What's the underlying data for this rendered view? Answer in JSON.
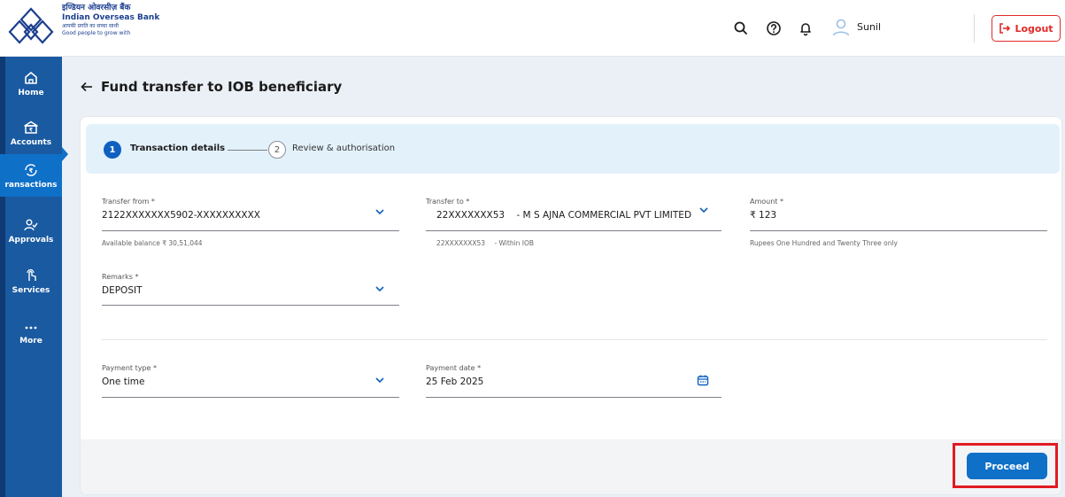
{
  "header": {
    "brand_hindi": "इण्डियन ओवरसीज़ बैंक",
    "brand_name": "Indian Overseas Bank",
    "tagline_hindi": "आपकी प्रगति का सच्चा साथी",
    "tagline": "Good people to grow with",
    "user_name": "Sunil",
    "logout_label": "Logout",
    "icons": [
      "search-icon",
      "help-icon",
      "bell-icon",
      "user-icon"
    ]
  },
  "sidebar": {
    "items": [
      {
        "label": "Home",
        "icon": "home-icon"
      },
      {
        "label": "Accounts",
        "icon": "bank-icon"
      },
      {
        "label": "ransactions",
        "icon": "rupee-exchange-icon",
        "active": true
      },
      {
        "label": "Approvals",
        "icon": "approvals-icon"
      },
      {
        "label": "Services",
        "icon": "hand-tap-icon"
      },
      {
        "label": "More",
        "icon": "more-dots-icon"
      }
    ]
  },
  "page": {
    "title": "Fund transfer to IOB beneficiary"
  },
  "stepper": {
    "steps": [
      {
        "number": "1",
        "label": "Transaction details",
        "active": true
      },
      {
        "number": "2",
        "label": "Review & authorisation",
        "active": false
      }
    ]
  },
  "form": {
    "transfer_from": {
      "label": "Transfer from *",
      "value": "2122XXXXXXX5902-XXXXXXXXXX",
      "helper": "Available balance ₹ 30,51,044"
    },
    "transfer_to": {
      "label": "Transfer to *",
      "value_account": "22XXXXXXX53",
      "value_name": "- M S AJNA COMMERCIAL PVT LIMITED",
      "helper_account": "22XXXXXXX53",
      "helper_bank": "- Within IOB"
    },
    "amount": {
      "label": "Amount *",
      "value": "₹ 123",
      "helper": "Rupees One Hundred and Twenty Three only"
    },
    "remarks": {
      "label": "Remarks *",
      "value": "DEPOSIT"
    },
    "payment_type": {
      "label": "Payment type *",
      "value": "One time"
    },
    "payment_date": {
      "label": "Payment date *",
      "value": "25 Feb 2025"
    }
  },
  "actions": {
    "proceed_label": "Proceed"
  },
  "colors": {
    "primary": "#0f70c8",
    "sidebar": "#1a5aa1",
    "logout": "#e02a2a",
    "highlight": "#e11b22"
  }
}
